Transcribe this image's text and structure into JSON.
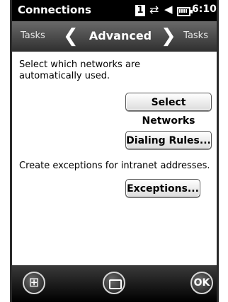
{
  "statusbar": {
    "title": "Connections",
    "badge": "1",
    "sync_icon": "sync-arrows-icon",
    "volume_icon": "speaker-icon",
    "battery_icon": "battery-icon",
    "time": "6:10"
  },
  "tabbar": {
    "left_tab": "Tasks",
    "current": "Advanced",
    "right_tab": "Tasks",
    "prev_icon": "chevron-left-icon",
    "next_icon": "chevron-right-icon"
  },
  "content": {
    "networks_text": "Select which networks are automatically used.",
    "select_networks_button": "Select Networks",
    "dialing_rules_button": "Dialing Rules...",
    "exceptions_text": "Create exceptions for intranet addresses.",
    "exceptions_button": "Exceptions..."
  },
  "bottombar": {
    "start_icon": "windows-start-icon",
    "keyboard_icon": "keyboard-icon",
    "ok_label": "OK"
  }
}
